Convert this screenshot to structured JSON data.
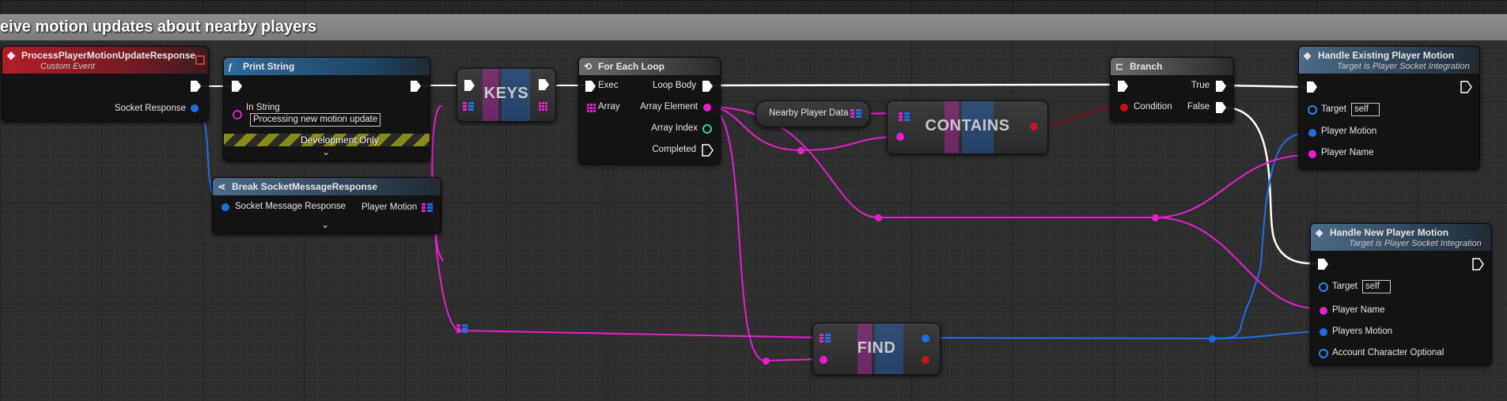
{
  "comment": {
    "title": "eive motion updates about nearby players"
  },
  "nodes": {
    "process_event": {
      "title": "ProcessPlayerMotionUpdateResponse",
      "subtitle": "Custom Event",
      "pin_socket_response": "Socket Response"
    },
    "print_string": {
      "title": "Print String",
      "pin_in_string": "In String",
      "in_string_value": "Processing new motion update",
      "dev_only": "Development Only"
    },
    "break_socket": {
      "title": "Break SocketMessageResponse",
      "pin_in": "Socket Message Response",
      "pin_out": "Player Motion"
    },
    "keys": {
      "label": "KEYS"
    },
    "for_each": {
      "title": "For Each Loop",
      "pin_exec": "Exec",
      "pin_array": "Array",
      "pin_loop_body": "Loop Body",
      "pin_array_element": "Array Element",
      "pin_array_index": "Array Index",
      "pin_completed": "Completed"
    },
    "nearby_var": {
      "label": "Nearby Player Data"
    },
    "contains": {
      "label": "CONTAINS"
    },
    "branch": {
      "title": "Branch",
      "pin_condition": "Condition",
      "pin_true": "True",
      "pin_false": "False"
    },
    "handle_existing": {
      "title": "Handle Existing Player Motion",
      "subtitle": "Target is Player Socket Integration",
      "pin_target": "Target",
      "target_value": "self",
      "pin_player_motion": "Player Motion",
      "pin_player_name": "Player Name"
    },
    "handle_new": {
      "title": "Handle New Player Motion",
      "subtitle": "Target is Player Socket Integration",
      "pin_target": "Target",
      "target_value": "self",
      "pin_player_name": "Player Name",
      "pin_players_motion": "Players Motion",
      "pin_account_char": "Account Character Optional"
    },
    "find": {
      "label": "FIND"
    }
  },
  "colors": {
    "exec": "#ffffff",
    "struct": "#1e6fe6",
    "string_name": "#e81fd0",
    "bool": "#c1161b",
    "int": "#2bd1b1"
  }
}
